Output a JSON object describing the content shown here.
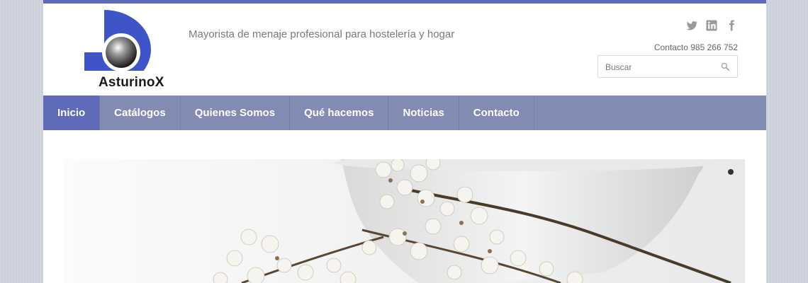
{
  "brand": {
    "name": "AsturinoX",
    "tagline": "Mayorista de menaje profesional para hostelería y hogar",
    "accent": "#5d6bb8"
  },
  "header": {
    "contact": "Contacto 985 266 752",
    "social": [
      "twitter-icon",
      "linkedin-icon",
      "facebook-icon"
    ],
    "search": {
      "placeholder": "Buscar"
    }
  },
  "nav": {
    "items": [
      {
        "label": "Inicio",
        "active": true
      },
      {
        "label": "Catálogos"
      },
      {
        "label": "Quienes Somos"
      },
      {
        "label": "Qué hacemos"
      },
      {
        "label": "Noticias"
      },
      {
        "label": "Contacto"
      }
    ],
    "bg": "#828bb1",
    "active_bg": "#5f6bb9"
  },
  "slider": {
    "indicator": "slide-dot"
  }
}
